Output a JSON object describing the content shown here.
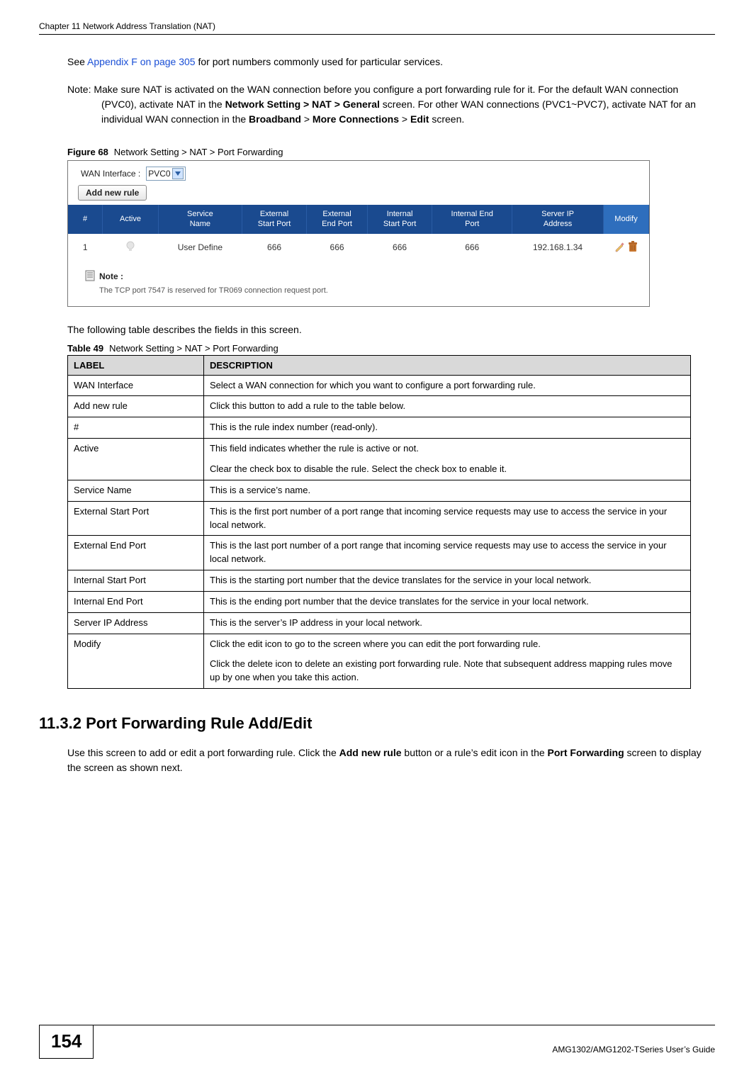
{
  "header": {
    "running_head": "Chapter 11 Network Address Translation (NAT)"
  },
  "intro": {
    "see_prefix": "See ",
    "appendix_link": "Appendix F on page 305",
    "see_suffix": " for port numbers commonly used for particular services.",
    "note_label": "Note: ",
    "note_a": "Make sure NAT is activated on the WAN connection before you configure a port forwarding rule for it. For the default WAN connection (PVC0), activate NAT in the ",
    "note_b_bold": "Network Setting > NAT > General",
    "note_c": " screen. For other WAN connections (PVC1~PVC7), activate NAT for an individual WAN connection in the ",
    "note_d_bold": "Broadband",
    "note_e": " > ",
    "note_f_bold": "More Connections",
    "note_g": " > ",
    "note_h_bold": "Edit",
    "note_i": " screen."
  },
  "figure": {
    "label": "Figure 68",
    "caption": "Network Setting > NAT > Port Forwarding"
  },
  "screenshot": {
    "wan_label": "WAN Interface :",
    "wan_value": "PVC0",
    "add_rule_btn": "Add new rule",
    "cols": {
      "num": "#",
      "active": "Active",
      "service": "Service\nName",
      "ext_start": "External\nStart Port",
      "ext_end": "External\nEnd Port",
      "int_start": "Internal\nStart Port",
      "int_end": "Internal End\nPort",
      "server_ip": "Server IP\nAddress",
      "modify": "Modify"
    },
    "row": {
      "num": "1",
      "service": "User Define",
      "ext_start": "666",
      "ext_end": "666",
      "int_start": "666",
      "int_end": "666",
      "server_ip": "192.168.1.34"
    },
    "note_head": "Note :",
    "note_body": "The TCP port  7547 is reserved for TR069 connection request port."
  },
  "after_fig": "The following table describes the fields in this screen.",
  "table49": {
    "label": "Table 49",
    "caption": "Network Setting > NAT > Port Forwarding",
    "head_label": "LABEL",
    "head_desc": "DESCRIPTION",
    "rows": [
      {
        "label": "WAN Interface",
        "desc": "Select a WAN connection for which you want to configure a port forwarding rule."
      },
      {
        "label": "Add new rule",
        "desc": "Click this button to add a rule to the table below."
      },
      {
        "label": "#",
        "desc": "This is the rule index number (read-only)."
      },
      {
        "label": "Active",
        "desc": "This field indicates whether the rule is active or not.",
        "desc2": "Clear the check box to disable the rule. Select the check box to enable it."
      },
      {
        "label": "Service Name",
        "desc": "This is a service’s name."
      },
      {
        "label": "External Start Port",
        "desc": "This is the first port number of a port range that incoming service requests may use to access the service in your local network."
      },
      {
        "label": "External End Port",
        "desc": "This is the last port number of a port range that incoming service requests may use to access the service in your local network."
      },
      {
        "label": "Internal Start Port",
        "desc": "This is the starting port number that the device translates for the service in your local network."
      },
      {
        "label": "Internal End Port",
        "desc": "This is the ending port number that the device translates for the service in your local network."
      },
      {
        "label": "Server IP Address",
        "desc": "This is the server’s IP address in your local network."
      },
      {
        "label": "Modify",
        "desc": "Click the edit icon to go to the screen where you can edit the port forwarding rule.",
        "desc2": "Click the delete icon to delete an existing port forwarding rule. Note that subsequent address mapping rules move up by one when you take this action."
      }
    ]
  },
  "section": {
    "heading": "11.3.2  Port Forwarding Rule Add/Edit",
    "body_a": "Use this screen to add or edit a port forwarding rule. Click the ",
    "body_b_bold": "Add new rule",
    "body_c": " button or a rule’s edit icon in the ",
    "body_d_bold": "Port Forwarding",
    "body_e": " screen to display the screen as shown next."
  },
  "footer": {
    "page_num": "154",
    "guide": "AMG1302/AMG1202-TSeries User’s Guide"
  }
}
